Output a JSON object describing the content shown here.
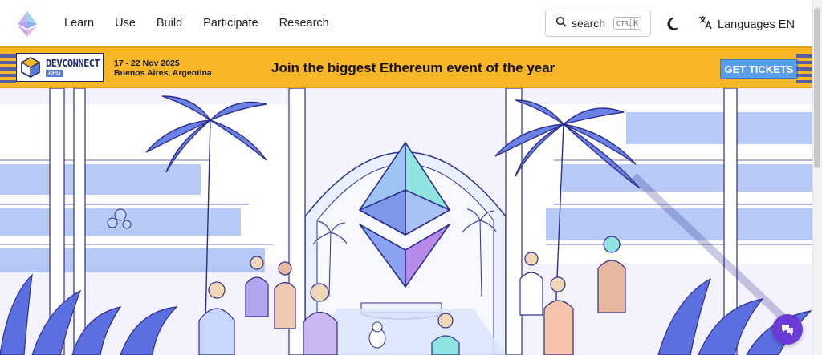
{
  "header": {
    "logo_icon": "ethereum-logo",
    "nav": [
      {
        "label": "Learn"
      },
      {
        "label": "Use"
      },
      {
        "label": "Build"
      },
      {
        "label": "Participate"
      },
      {
        "label": "Research"
      }
    ],
    "search": {
      "label": "search",
      "shortcut_ctrl": "CTRL",
      "shortcut_key": "K",
      "icon": "search-icon"
    },
    "theme_toggle_icon": "moon-icon",
    "language": {
      "label": "Languages EN",
      "icon": "translate-icon"
    }
  },
  "banner": {
    "brand": "DEVCONNECT",
    "brand_sub": "ARG",
    "date": "17 - 22 Nov 2025",
    "location": "Buenos Aires, Argentina",
    "headline": "Join the biggest Ethereum event of the year",
    "cta": "GET TICKETS",
    "colors": {
      "background": "#f7b728",
      "cta": "#5a9ef0",
      "accent": "#1c2a6b"
    }
  },
  "hero": {
    "illustration": "ethereum-atrium-illustration",
    "colors": {
      "eth_top": "#8fe3e0",
      "eth_left": "#8aa3f0",
      "eth_bottom": "#b58ae8",
      "line": "#2d2f8f"
    }
  },
  "chat_button": {
    "icon": "chat-icon",
    "color": "#6c3ad8"
  }
}
